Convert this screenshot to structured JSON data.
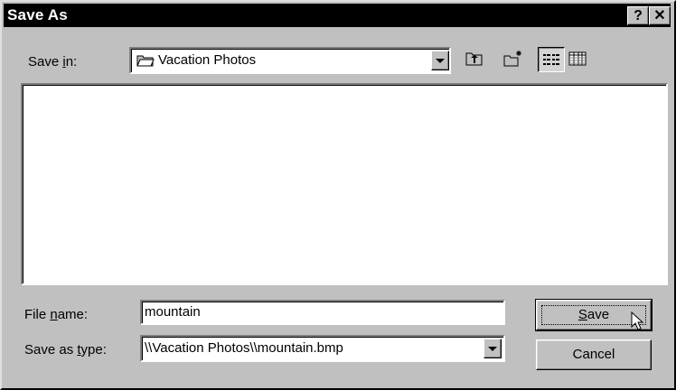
{
  "window": {
    "title": "Save As",
    "help_label": "?",
    "close_label": "✕"
  },
  "save_in": {
    "label_pre": "Save ",
    "label_accel": "i",
    "label_post": "n:",
    "value": "Vacation Photos"
  },
  "toolbar": {
    "up_one_level": "up-folder-icon",
    "new_folder": "new-folder-icon",
    "list_view": "list-view-icon",
    "details_view": "details-view-icon",
    "active_view": "list"
  },
  "file_list": {
    "items": []
  },
  "file_name": {
    "label_pre": "File ",
    "label_accel": "n",
    "label_post": "ame:",
    "value": "mountain"
  },
  "save_as_type": {
    "label_pre": "Save as ",
    "label_accel": "t",
    "label_post": "ype:",
    "value": "\\\\Vacation Photos\\\\mountain.bmp"
  },
  "buttons": {
    "save_accel": "S",
    "save_rest": "ave",
    "cancel": "Cancel"
  },
  "colors": {
    "face": "#c0c0c0",
    "titlebar": "#000000",
    "title_text": "#ffffff"
  }
}
